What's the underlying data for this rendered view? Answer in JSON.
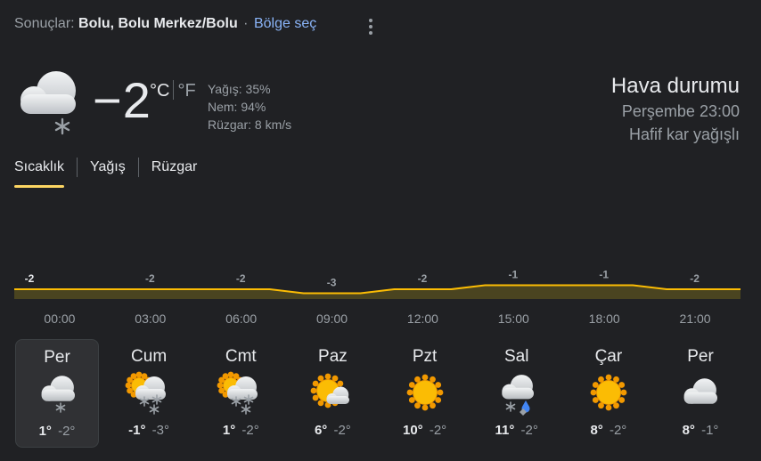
{
  "header": {
    "prefix": "Sonuçlar:",
    "location": "Bolu, Bolu Merkez/Bolu",
    "separator": "·",
    "region_link": "Bölge seç"
  },
  "current": {
    "icon": "cloud-snow-icon",
    "temp": "−2",
    "unit_c": "°C",
    "unit_f": "°F",
    "precip": "Yağış: 35%",
    "humidity": "Nem: 94%",
    "wind": "Rüzgar: 8 km/s"
  },
  "summary": {
    "title": "Hava durumu",
    "time": "Perşembe 23:00",
    "condition": "Hafif kar yağışlı"
  },
  "tabs": [
    {
      "label": "Sıcaklık",
      "active": true
    },
    {
      "label": "Yağış",
      "active": false
    },
    {
      "label": "Rüzgar",
      "active": false
    }
  ],
  "chart_data": {
    "type": "area",
    "x": [
      "00:00",
      "03:00",
      "06:00",
      "09:00",
      "12:00",
      "15:00",
      "18:00",
      "21:00"
    ],
    "series": [
      {
        "values": [
          -2,
          -2,
          -2,
          -3,
          -2,
          -1,
          -1,
          -2
        ]
      }
    ],
    "point_labels": [
      "-2",
      "-2",
      "-2",
      "-3",
      "-2",
      "-1",
      "-1",
      "-2"
    ],
    "colors": {
      "line": "#fbbc04",
      "fill": "#4a4420"
    }
  },
  "days": [
    {
      "name": "Per",
      "icon": "cloud-snow-icon",
      "hi": "1°",
      "lo": "-2°",
      "selected": true
    },
    {
      "name": "Cum",
      "icon": "partly-cloudy-snow-icon",
      "hi": "-1°",
      "lo": "-3°",
      "selected": false
    },
    {
      "name": "Cmt",
      "icon": "partly-cloudy-snow-icon",
      "hi": "1°",
      "lo": "-2°",
      "selected": false
    },
    {
      "name": "Paz",
      "icon": "partly-sunny-icon",
      "hi": "6°",
      "lo": "-2°",
      "selected": false
    },
    {
      "name": "Pzt",
      "icon": "sun-icon",
      "hi": "10°",
      "lo": "-2°",
      "selected": false
    },
    {
      "name": "Sal",
      "icon": "cloud-snow-rain-icon",
      "hi": "11°",
      "lo": "-2°",
      "selected": false
    },
    {
      "name": "Çar",
      "icon": "sun-icon",
      "hi": "8°",
      "lo": "-2°",
      "selected": false
    },
    {
      "name": "Per",
      "icon": "cloud-icon",
      "hi": "8°",
      "lo": "-1°",
      "selected": false
    }
  ],
  "colors": {
    "background": "#202124",
    "accent": "#fdd663",
    "link": "#8ab4f8",
    "sun": "#fbbc04"
  }
}
